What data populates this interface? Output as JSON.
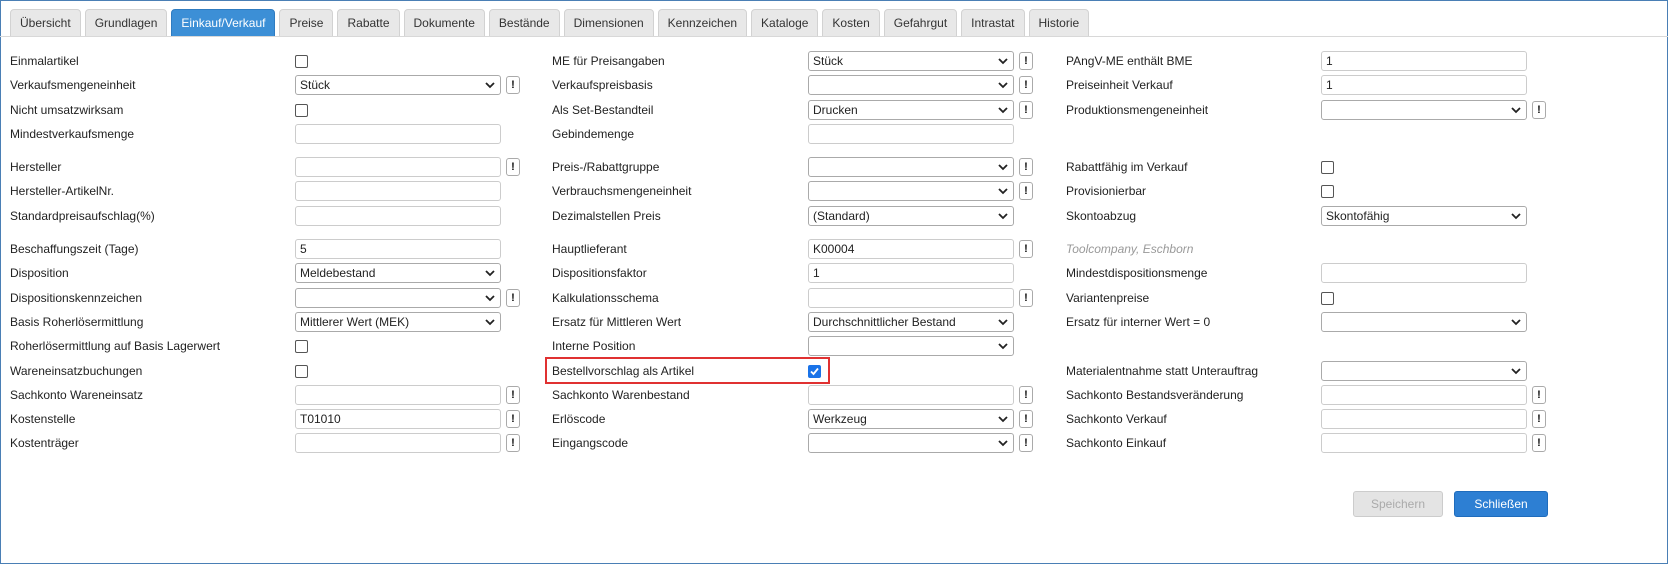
{
  "tabs": [
    "Übersicht",
    "Grundlagen",
    "Einkauf/Verkauf",
    "Preise",
    "Rabatte",
    "Dokumente",
    "Bestände",
    "Dimensionen",
    "Kennzeichen",
    "Kataloge",
    "Kosten",
    "Gefahrgut",
    "Intrastat",
    "Historie"
  ],
  "active_tab": "Einkauf/Verkauf",
  "col1": {
    "einmalartikel": "Einmalartikel",
    "verkaufsmengeneinheit": "Verkaufsmengeneinheit",
    "verkaufsmengeneinheit_value": "Stück",
    "nicht_umsatzwirksam": "Nicht umsatzwirksam",
    "mindestverkaufsmenge": "Mindestverkaufsmenge",
    "hersteller": "Hersteller",
    "hersteller_artikelnr": "Hersteller-ArtikelNr.",
    "standardpreisaufschlag": "Standardpreisaufschlag(%)",
    "beschaffungszeit": "Beschaffungszeit (Tage)",
    "beschaffungszeit_value": "5",
    "disposition": "Disposition",
    "disposition_value": "Meldebestand",
    "dispositionskennzeichen": "Dispositionskennzeichen",
    "basis_roherloes": "Basis Roherlösermittlung",
    "basis_roherloes_value": "Mittlerer Wert (MEK)",
    "roherloes_lagerwert": "Roherlösermittlung auf Basis Lagerwert",
    "wareneinsatzbuchungen": "Wareneinsatzbuchungen",
    "sachkonto_wareneinsatz": "Sachkonto Wareneinsatz",
    "kostenstelle": "Kostenstelle",
    "kostenstelle_value": "T01010",
    "kostentraeger": "Kostenträger"
  },
  "col2": {
    "me_preisangaben": "ME für Preisangaben",
    "me_preisangaben_value": "Stück",
    "verkaufspreisbasis": "Verkaufspreisbasis",
    "set_bestandteil": "Als Set-Bestandteil",
    "set_bestandteil_value": "Drucken",
    "gebindemenge": "Gebindemenge",
    "preis_rabattgruppe": "Preis-/Rabattgruppe",
    "verbrauchsmengeneinheit": "Verbrauchsmengeneinheit",
    "dezimalstellen_preis": "Dezimalstellen Preis",
    "dezimalstellen_preis_value": "(Standard)",
    "hauptlieferant": "Hauptlieferant",
    "hauptlieferant_value": "K00004",
    "dispositionsfaktor": "Dispositionsfaktor",
    "dispositionsfaktor_value": "1",
    "kalkulationsschema": "Kalkulationsschema",
    "ersatz_mittlerer_wert": "Ersatz für Mittleren Wert",
    "ersatz_mittlerer_wert_value": "Durchschnittlicher Bestand",
    "interne_position": "Interne Position",
    "bestellvorschlag": "Bestellvorschlag als Artikel",
    "bestellvorschlag_checked": true,
    "sachkonto_warenbestand": "Sachkonto Warenbestand",
    "erloescode": "Erlöscode",
    "erloescode_value": "Werkzeug",
    "eingangscode": "Eingangscode"
  },
  "col3": {
    "pangv": "PAngV-ME enthält BME",
    "pangv_value": "1",
    "preiseinheit_verkauf": "Preiseinheit Verkauf",
    "preiseinheit_verkauf_value": "1",
    "produktionsmengeneinheit": "Produktionsmengeneinheit",
    "rabattfaehig": "Rabattfähig im Verkauf",
    "provisionierbar": "Provisionierbar",
    "skontoabzug": "Skontoabzug",
    "skontoabzug_value": "Skontofähig",
    "lieferant_name": "Toolcompany, Eschborn",
    "mindestdispositionsmenge": "Mindestdispositionsmenge",
    "variantenpreise": "Variantenpreise",
    "ersatz_interner_wert": "Ersatz für interner Wert = 0",
    "materialentnahme": "Materialentnahme statt Unterauftrag",
    "sachkonto_bestandsveraenderung": "Sachkonto Bestandsveränderung",
    "sachkonto_verkauf": "Sachkonto Verkauf",
    "sachkonto_einkauf": "Sachkonto Einkauf"
  },
  "info_glyph": "!",
  "buttons": {
    "save": "Speichern",
    "close": "Schließen"
  }
}
